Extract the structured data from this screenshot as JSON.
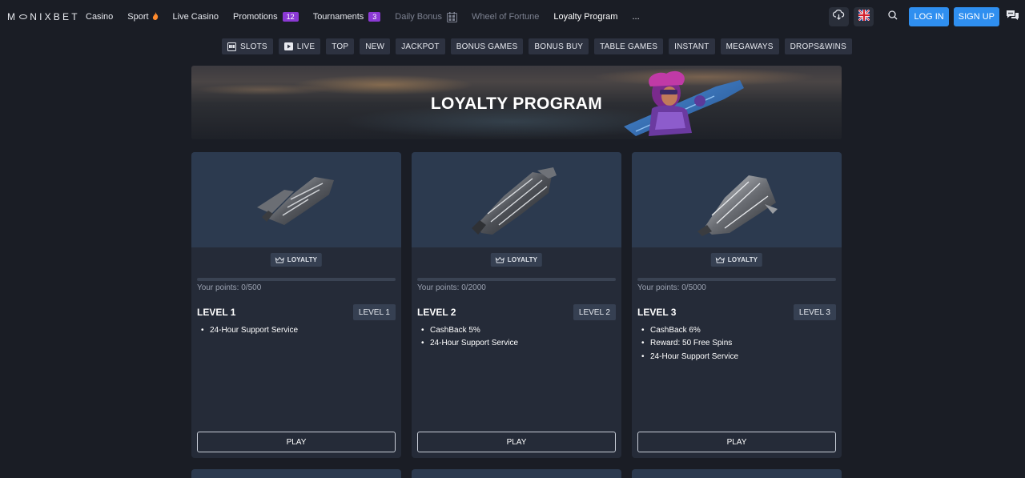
{
  "brand": {
    "logo_text_a": "M",
    "logo_text_b": "NIXBET"
  },
  "nav": {
    "items": [
      {
        "label": "Casino"
      },
      {
        "label": "Sport",
        "icon": "flame-icon"
      },
      {
        "label": "Live Casino"
      },
      {
        "label": "Promotions",
        "badge": "12"
      },
      {
        "label": "Tournaments",
        "badge": "3"
      },
      {
        "label": "Daily Bonus",
        "icon": "calendar-gift-icon"
      },
      {
        "label": "Wheel of Fortune"
      },
      {
        "label": "Loyalty Program"
      },
      {
        "label": "..."
      }
    ]
  },
  "header_actions": {
    "login": "LOG IN",
    "signup": "SIGN UP"
  },
  "categories": [
    "SLOTS",
    "LIVE",
    "TOP",
    "NEW",
    "JACKPOT",
    "BONUS GAMES",
    "BONUS BUY",
    "TABLE GAMES",
    "INSTANT",
    "MEGAWAYS",
    "DROPS&WINS"
  ],
  "banner": {
    "title": "LOYALTY PROGRAM"
  },
  "cards": [
    {
      "tag": "LOYALTY",
      "points": "Your points: 0/500",
      "progress": 0,
      "level_title": "LEVEL 1",
      "level_tag": "LEVEL 1",
      "perks": [
        "24-Hour Support Service"
      ],
      "play": "PLAY"
    },
    {
      "tag": "LOYALTY",
      "points": "Your points: 0/2000",
      "progress": 0,
      "level_title": "LEVEL 2",
      "level_tag": "LEVEL 2",
      "perks": [
        "CashBack 5%",
        "24-Hour Support Service"
      ],
      "play": "PLAY"
    },
    {
      "tag": "LOYALTY",
      "points": "Your points: 0/5000",
      "progress": 0,
      "level_title": "LEVEL 3",
      "level_tag": "LEVEL 3",
      "perks": [
        "CashBack 6%",
        "Reward: 50 Free Spins",
        "24-Hour Support Service"
      ],
      "play": "PLAY"
    }
  ],
  "colors": {
    "accent": "#2f8ff0",
    "badge": "#8b39d4",
    "card": "#252b38",
    "background": "#1a1d25"
  }
}
